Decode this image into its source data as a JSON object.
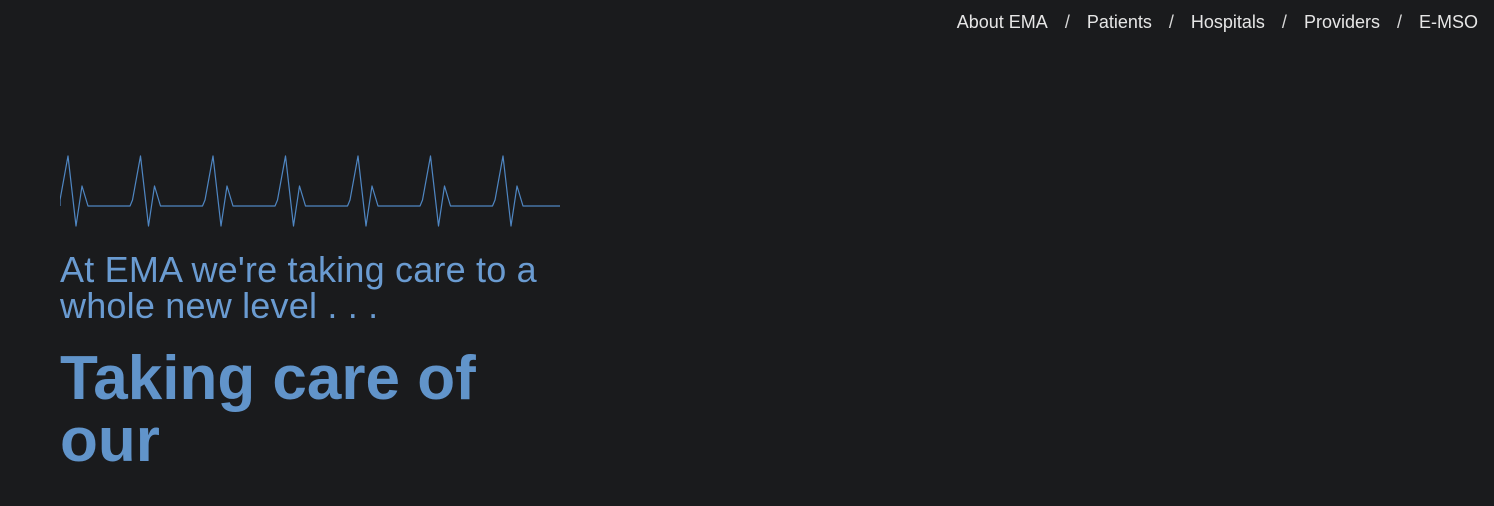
{
  "nav": {
    "items": [
      {
        "label": "About EMA"
      },
      {
        "label": "Patients"
      },
      {
        "label": "Hospitals"
      },
      {
        "label": "Providers"
      },
      {
        "label": "E-MSO"
      }
    ],
    "separator": "/"
  },
  "hero": {
    "tagline": "At EMA we're taking care to a whole new level . . .",
    "headline": "Taking care of our"
  },
  "colors": {
    "background": "#1a1b1d",
    "accent": "#6194ca",
    "nav_text": "#e6e6e6"
  },
  "icons": {
    "heartbeat": "heartbeat-line-icon"
  }
}
